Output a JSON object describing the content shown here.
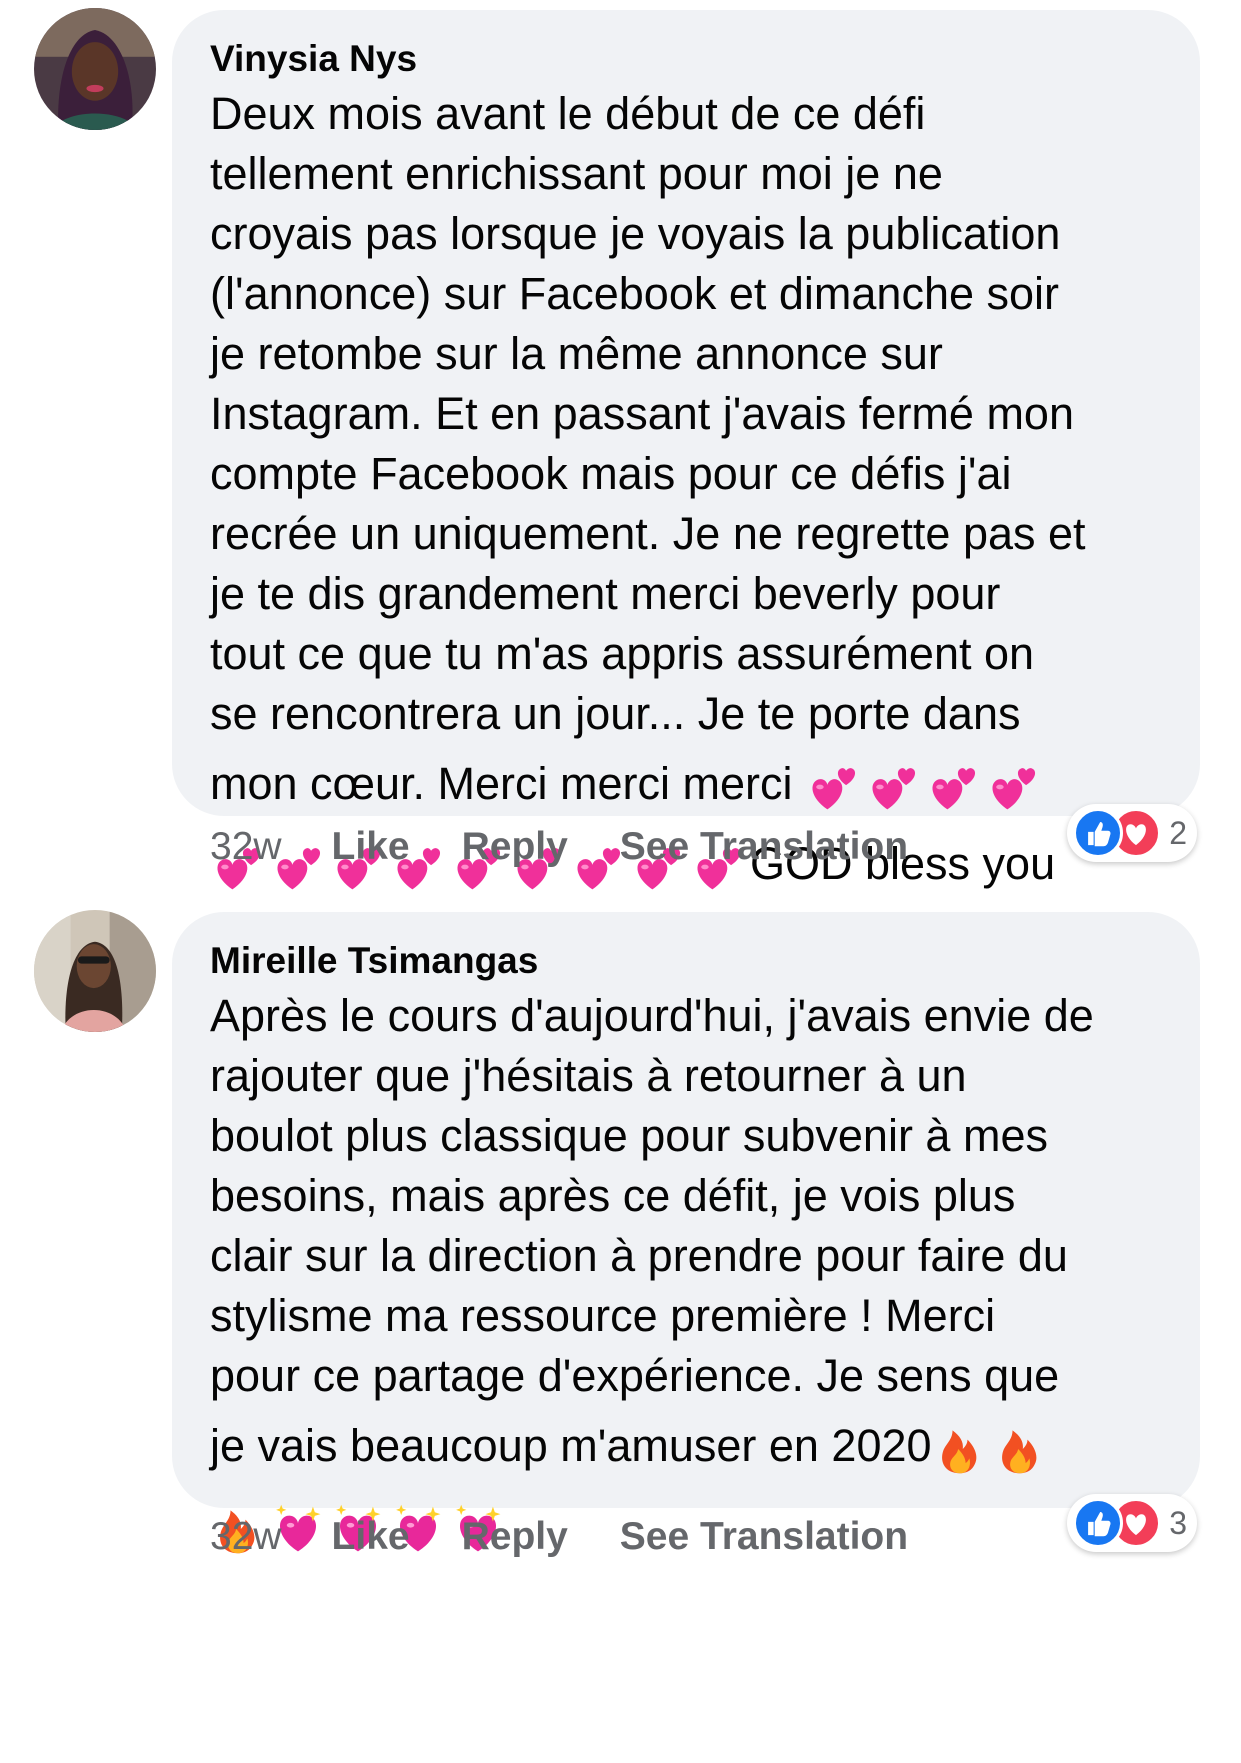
{
  "comments": [
    {
      "author": "Vinysia Nys",
      "lines": [
        "Deux mois avant le début de ce défi",
        "tellement enrichissant pour moi je ne",
        "croyais pas lorsque je voyais la publication",
        "(l'annonce) sur Facebook et dimanche soir",
        "je retombe sur la même annonce sur",
        "Instagram. Et en passant j'avais fermé mon",
        "compte Facebook mais pour ce défis j'ai",
        "recrée un uniquement. Je ne regrette pas et",
        "je te dis grandement merci beverly pour",
        "tout ce que tu m'as appris assurément on",
        "se rencontrera un jour... Je te porte dans"
      ],
      "emoji_line_1_text": "mon cœur. Merci merci merci",
      "emoji_line_1_emojis": [
        "two-hearts",
        "two-hearts",
        "two-hearts",
        "two-hearts"
      ],
      "emoji_line_2_emojis": [
        "two-hearts",
        "two-hearts",
        "two-hearts",
        "two-hearts",
        "two-hearts",
        "two-hearts",
        "two-hearts",
        "two-hearts",
        "two-hearts"
      ],
      "emoji_line_2_text": "GOD bless you",
      "time": "32w",
      "like_label": "Like",
      "reply_label": "Reply",
      "translate_label": "See Translation",
      "reaction_count": "2"
    },
    {
      "author": "Mireille Tsimangas",
      "lines": [
        "Après le cours d'aujourd'hui, j'avais envie de",
        "rajouter que j'hésitais à retourner à un",
        "boulot plus classique pour subvenir à mes",
        "besoins, mais après ce défit, je vois plus",
        "clair sur la direction à prendre pour faire du",
        "stylisme ma ressource première ! Merci",
        "pour ce partage d'expérience. Je sens que"
      ],
      "emoji_line_1_text": "je vais beaucoup m'amuser en 2020",
      "emoji_line_1_emojis": [
        "fire",
        "fire"
      ],
      "emoji_line_2_emojis": [
        "fire",
        "sparkling-heart",
        "sparkling-heart",
        "sparkling-heart",
        "sparkling-heart"
      ],
      "emoji_line_2_text": "",
      "time": "32w",
      "like_label": "Like",
      "reply_label": "Reply",
      "translate_label": "See Translation",
      "reaction_count": "3"
    }
  ],
  "colors": {
    "bubble": "#f0f2f5",
    "text": "#050505",
    "meta": "#65676b",
    "like_blue": "#1877f2",
    "love_red": "#f33e58",
    "heart_pink": "#f0309a"
  }
}
